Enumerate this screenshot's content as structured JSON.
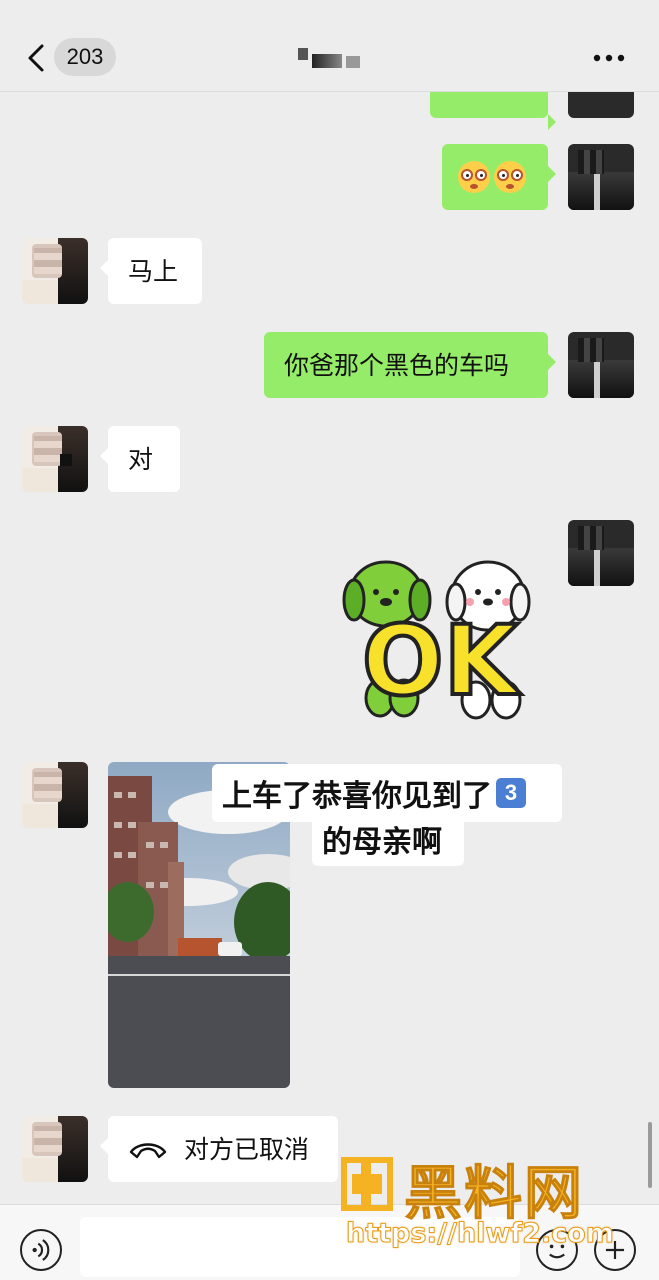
{
  "header": {
    "unread_count": "203"
  },
  "messages": [
    {
      "side": "right",
      "type": "emoji",
      "emojis": [
        "flushed-face-emoji",
        "flushed-face-emoji"
      ]
    },
    {
      "side": "left",
      "type": "text",
      "text": "马上"
    },
    {
      "side": "right",
      "type": "text",
      "text": "你爸那个黑色的车吗"
    },
    {
      "side": "left",
      "type": "text",
      "text": "对"
    },
    {
      "side": "right",
      "type": "sticker",
      "sticker": "ok-dogs-sticker",
      "sticker_text": "OK"
    },
    {
      "side": "left",
      "type": "image",
      "caption_line1": "上车了恭喜你见到了",
      "caption_badge": "3",
      "caption_line2": "的母亲啊"
    },
    {
      "side": "left",
      "type": "call",
      "text": "对方已取消"
    }
  ],
  "watermark": {
    "brand": "黑料网",
    "url": "https://hlwf2.com"
  },
  "colors": {
    "self_bubble": "#95ec69",
    "other_bubble": "#ffffff",
    "background": "#ededed",
    "watermark": "#f5b324"
  },
  "icons": {
    "back": "chevron-left-icon",
    "more": "more-dots-icon",
    "voice": "voice-icon",
    "emoji": "emoji-icon",
    "plus": "plus-icon",
    "call_cancel": "phone-hangup-icon"
  }
}
